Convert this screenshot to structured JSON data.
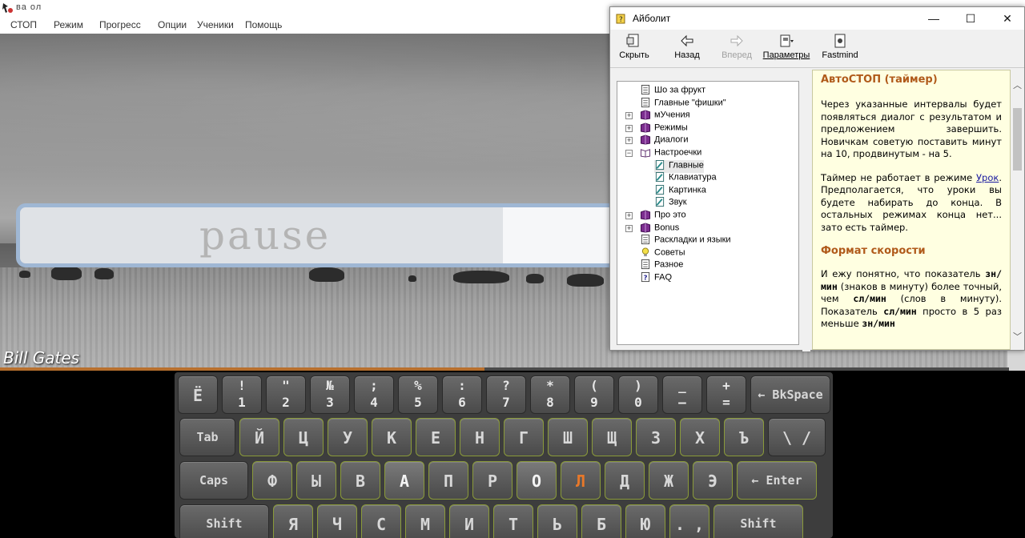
{
  "app": {
    "title": "ва  ол",
    "menu": [
      "СТОП",
      "Режим",
      "Прогресс",
      "Опции",
      "Ученики",
      "Помощь"
    ],
    "pause_text": "pause",
    "student_name": "Bill Gates",
    "progress_fraction": 0.48
  },
  "keyboard": {
    "row1": [
      {
        "main": "Ё"
      },
      {
        "top": "!",
        "bottom": "1"
      },
      {
        "top": "\"",
        "bottom": "2"
      },
      {
        "top": "№",
        "bottom": "3"
      },
      {
        "top": ";",
        "bottom": "4"
      },
      {
        "top": "%",
        "bottom": "5"
      },
      {
        "top": ":",
        "bottom": "6"
      },
      {
        "top": "?",
        "bottom": "7"
      },
      {
        "top": "*",
        "bottom": "8"
      },
      {
        "top": "(",
        "bottom": "9"
      },
      {
        "top": ")",
        "bottom": "0"
      },
      {
        "top": "_",
        "bottom": "–"
      },
      {
        "top": "+",
        "bottom": "="
      },
      {
        "wide": "← BkSpace"
      }
    ],
    "row2": [
      {
        "wide": "Tab"
      },
      {
        "main": "Й"
      },
      {
        "main": "Ц"
      },
      {
        "main": "У"
      },
      {
        "main": "К"
      },
      {
        "main": "Е"
      },
      {
        "main": "Н"
      },
      {
        "main": "Г"
      },
      {
        "main": "Ш"
      },
      {
        "main": "Щ"
      },
      {
        "main": "З"
      },
      {
        "main": "Х"
      },
      {
        "main": "Ъ"
      },
      {
        "main": "\\ /"
      }
    ],
    "row3": [
      {
        "wide": "Caps"
      },
      {
        "main": "Ф"
      },
      {
        "main": "Ы"
      },
      {
        "main": "В"
      },
      {
        "main": "А"
      },
      {
        "main": "П"
      },
      {
        "main": "Р"
      },
      {
        "main": "О"
      },
      {
        "main": "Л"
      },
      {
        "main": "Д"
      },
      {
        "main": "Ж"
      },
      {
        "main": "Э"
      },
      {
        "wide": "← Enter"
      }
    ],
    "row4": [
      {
        "wide": "Shift"
      },
      {
        "main": "Я"
      },
      {
        "main": "Ч"
      },
      {
        "main": "С"
      },
      {
        "main": "М"
      },
      {
        "main": "И"
      },
      {
        "main": "Т"
      },
      {
        "main": "Ь"
      },
      {
        "main": "Б"
      },
      {
        "main": "Ю"
      },
      {
        "main": ". ,"
      },
      {
        "wide": "Shift"
      }
    ],
    "accent_key": "Л",
    "accent_color": "#e7782a"
  },
  "help": {
    "title": "Айболит",
    "window_buttons": {
      "minimize": "—",
      "maximize": "☐",
      "close": "✕"
    },
    "toolbar": [
      {
        "label": "Скрыть",
        "icon": "hide-icon",
        "enabled": true
      },
      {
        "label": "Назад",
        "icon": "back-arrow-icon",
        "enabled": true
      },
      {
        "label": "Вперед",
        "icon": "forward-arrow-icon",
        "enabled": false
      },
      {
        "label": "Параметры",
        "icon": "options-icon",
        "enabled": true
      },
      {
        "label": "Fastmind",
        "icon": "fastmind-icon",
        "enabled": true
      }
    ],
    "tree": [
      {
        "label": "Шо за фрукт",
        "level": 0,
        "icon": "page",
        "expander": ""
      },
      {
        "label": "Главные \"фишки\"",
        "level": 0,
        "icon": "page",
        "expander": ""
      },
      {
        "label": "мУчения",
        "level": 0,
        "icon": "book",
        "expander": "+"
      },
      {
        "label": "Режимы",
        "level": 0,
        "icon": "book",
        "expander": "+"
      },
      {
        "label": "Диалоги",
        "level": 0,
        "icon": "book",
        "expander": "+"
      },
      {
        "label": "Настроечки",
        "level": 0,
        "icon": "book-open",
        "expander": "−"
      },
      {
        "label": "Главные",
        "level": 1,
        "icon": "link-page",
        "expander": "",
        "selected": true
      },
      {
        "label": "Клавиатура",
        "level": 1,
        "icon": "link-page",
        "expander": ""
      },
      {
        "label": "Картинка",
        "level": 1,
        "icon": "link-page",
        "expander": ""
      },
      {
        "label": "Звук",
        "level": 1,
        "icon": "link-page",
        "expander": ""
      },
      {
        "label": "Про это",
        "level": 0,
        "icon": "book",
        "expander": "+"
      },
      {
        "label": "Bonus",
        "level": 0,
        "icon": "book",
        "expander": "+"
      },
      {
        "label": "Раскладки и языки",
        "level": 0,
        "icon": "page",
        "expander": ""
      },
      {
        "label": "Советы",
        "level": 0,
        "icon": "bulb",
        "expander": ""
      },
      {
        "label": "Разное",
        "level": 0,
        "icon": "page",
        "expander": ""
      },
      {
        "label": "FAQ",
        "level": 0,
        "icon": "question",
        "expander": ""
      }
    ],
    "content": {
      "heading1": "АвтоСТОП (таймер)",
      "para1": "Через указанные интервалы будет появляться диалог с результатом и предложением завершить. Новичкам советую поставить минут на 10, продвинутым - на 5.",
      "para2_pre": "Таймер не работает в режиме ",
      "para2_link": "Урок",
      "para2_post": ". Предполагается, что уроки вы будете набирать до конца. В остальных режимах конца нет... зато есть таймер.",
      "heading2": "Формат скорости",
      "para3_a": "И ежу понятно, что показатель ",
      "para3_b": "зн/мин",
      "para3_c": " (знаков в минуту) более точный, чем ",
      "para3_d": "сл/мин",
      "para3_e": " (слов в минуту). Показатель ",
      "para3_f": "сл/мин",
      "para3_g": " просто в 5 раз меньше ",
      "para3_h": "зн/мин"
    },
    "scroll": {
      "up": "︿",
      "down": "﹀"
    }
  }
}
